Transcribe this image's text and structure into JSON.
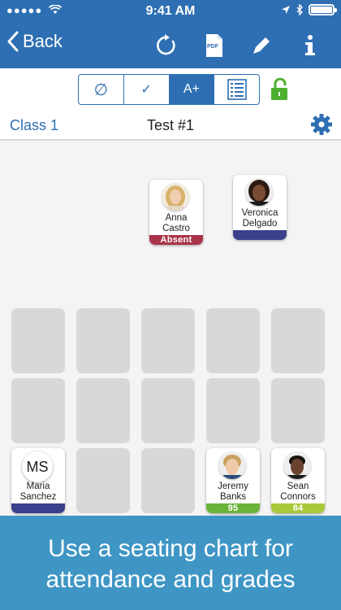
{
  "status": {
    "time": "9:41 AM"
  },
  "nav": {
    "back_label": "Back"
  },
  "pdf_icon_label": "PDF",
  "modes": [
    {
      "label": "∅",
      "icon": "empty-set-icon"
    },
    {
      "label": "✓",
      "icon": "checkmark-icon"
    },
    {
      "label": "A+",
      "icon": "grade-icon",
      "active": true
    },
    {
      "label": "",
      "icon": "list-icon"
    }
  ],
  "class_bar": {
    "class_name": "Class 1",
    "test_name": "Test #1"
  },
  "students": {
    "anna": {
      "first": "Anna",
      "last": "Castro",
      "status": "Absent",
      "status_color": "#a9344a"
    },
    "veronica": {
      "first": "Veronica",
      "last": "Delgado",
      "status": "",
      "status_color": "#3b3f8c"
    },
    "maria": {
      "first": "Maria",
      "last": "Sanchez",
      "initials": "MS",
      "status": "",
      "status_color": "#3b3f8c"
    },
    "jeremy": {
      "first": "Jeremy",
      "last": "Banks",
      "grade": "95",
      "grade_color": "#6bb43a"
    },
    "sean": {
      "first": "Sean",
      "last": "Connors",
      "grade": "84",
      "grade_color": "#a8c93a"
    }
  },
  "banner": {
    "line1": "Use a seating chart for",
    "line2": "attendance and grades"
  },
  "colors": {
    "accent": "#2e6fb3",
    "lock": "#4caf2e",
    "banner": "#3f96c5"
  }
}
